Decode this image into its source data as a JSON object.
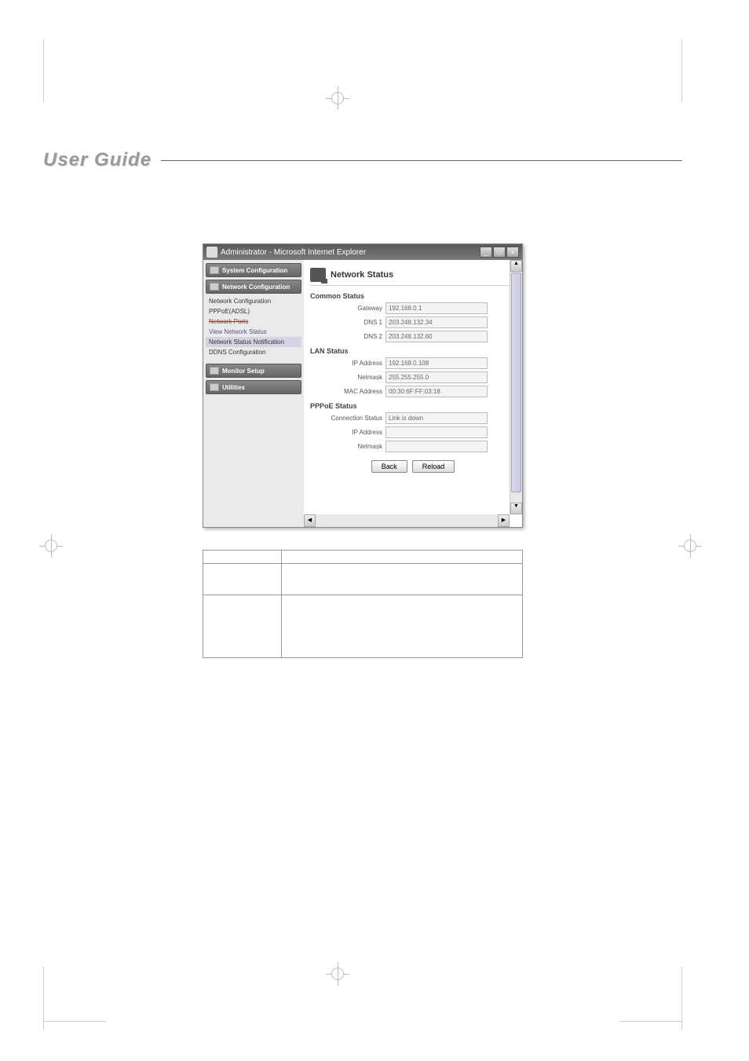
{
  "header": {
    "title": "User Guide"
  },
  "window": {
    "title": "Administrator - Microsoft Internet Explorer",
    "controls": {
      "min": "_",
      "max": "□",
      "close": "×"
    }
  },
  "sidebar": {
    "sections": [
      {
        "label": "System Configuration"
      },
      {
        "label": "Network Configuration"
      }
    ],
    "items": [
      {
        "label": "Network Configuration"
      },
      {
        "label": "PPPoE(ADSL)"
      },
      {
        "label": "Network Ports"
      },
      {
        "label": "View Network Status"
      },
      {
        "label": "Network Status Notification"
      },
      {
        "label": "DDNS Configuration"
      }
    ],
    "sections2": [
      {
        "label": "Monitor Setup"
      },
      {
        "label": "Utilities"
      }
    ]
  },
  "panel": {
    "title": "Network Status",
    "common": {
      "heading": "Common Status",
      "gateway_label": "Gateway",
      "gateway": "192.168.0.1",
      "dns1_label": "DNS 1",
      "dns1": "203.248.132.34",
      "dns2_label": "DNS 2",
      "dns2": "203.248.132.60"
    },
    "lan": {
      "heading": "LAN Status",
      "ip_label": "IP Address",
      "ip": "192.168.0.108",
      "netmask_label": "Netmask",
      "netmask": "255.255.255.0",
      "mac_label": "MAC Address",
      "mac": "00:30:6F:FF:03:18"
    },
    "pppoe": {
      "heading": "PPPoE Status",
      "conn_label": "Connection Status",
      "conn": "Link is down",
      "ip_label": "IP Address",
      "ip": "",
      "netmask_label": "Netmask",
      "netmask": ""
    },
    "buttons": {
      "back": "Back",
      "reload": "Reload"
    }
  },
  "table": {
    "rows": [
      {
        "c1": "",
        "c2": ""
      },
      {
        "c1": "",
        "c2": ""
      },
      {
        "c1": "",
        "c2": ""
      }
    ]
  }
}
